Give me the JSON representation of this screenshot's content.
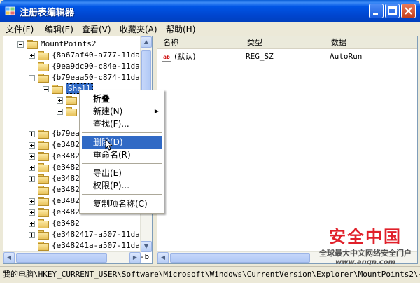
{
  "window": {
    "title": "注册表编辑器"
  },
  "menubar": [
    "文件(F)",
    "编辑(E)",
    "查看(V)",
    "收藏夹(A)",
    "帮助(H)"
  ],
  "tree": [
    {
      "label": "MountPoints2",
      "level": 0,
      "expander": "minus"
    },
    {
      "label": "{8a67af40-a777-11da-b",
      "level": 1,
      "expander": "plus"
    },
    {
      "label": "{9ea9dc90-c84e-11da-a",
      "level": 1,
      "expander": "none"
    },
    {
      "label": "{b79eaa50-c874-11da-8",
      "level": 1,
      "expander": "minus"
    },
    {
      "label": "Shell",
      "level": 2,
      "expander": "minus",
      "selected": true
    },
    {
      "label": "",
      "level": 3,
      "expander": "plus"
    },
    {
      "label": "",
      "level": 3,
      "expander": "minus"
    },
    {
      "label": "",
      "level": 4,
      "expander": "none"
    },
    {
      "label": "{b79eaa",
      "level": 1,
      "expander": "plus"
    },
    {
      "label": "{e3482",
      "level": 1,
      "expander": "plus"
    },
    {
      "label": "{e3482",
      "level": 1,
      "expander": "plus"
    },
    {
      "label": "{e3482",
      "level": 1,
      "expander": "plus"
    },
    {
      "label": "{e3482",
      "level": 1,
      "expander": "plus"
    },
    {
      "label": "{e3482",
      "level": 1,
      "expander": "none"
    },
    {
      "label": "{e3482",
      "level": 1,
      "expander": "plus"
    },
    {
      "label": "{e3482",
      "level": 1,
      "expander": "plus"
    },
    {
      "label": "{e3482",
      "level": 1,
      "expander": "plus"
    },
    {
      "label": "{e3482417-a507-11da-8",
      "level": 1,
      "expander": "plus"
    },
    {
      "label": "{e348241a-a507-11da-8",
      "level": 1,
      "expander": "none"
    },
    {
      "label": "{fd18d2ed-a4d6-11da-b",
      "level": 1,
      "expander": "plus"
    }
  ],
  "list": {
    "headers": [
      "名称",
      "类型",
      "数据"
    ],
    "rows": [
      {
        "name": "(默认)",
        "type": "REG_SZ",
        "data": "AutoRun",
        "icon": "string-value-icon",
        "icon_text": "ab"
      }
    ]
  },
  "context_menu": {
    "items": [
      {
        "label": "折叠",
        "bold": true
      },
      {
        "label": "新建(N)",
        "submenu": true
      },
      {
        "label": "查找(F)..."
      },
      {
        "label": "删除(D)",
        "highlighted": true
      },
      {
        "label": "重命名(R)"
      },
      {
        "label": "导出(E)"
      },
      {
        "label": "权限(P)..."
      },
      {
        "label": "复制项名称(C)"
      }
    ]
  },
  "status_bar": "我的电脑\\HKEY_CURRENT_USER\\Software\\Microsoft\\Windows\\CurrentVersion\\Explorer\\MountPoints2\\{b79",
  "watermark": {
    "title": "安全中国",
    "subtitle": "全球最大中文网络安全门户",
    "url": "www.anqn.com"
  },
  "colors": {
    "titlebar": "#0055e5",
    "selection": "#316ac5",
    "watermark_red": "#e0202a"
  }
}
